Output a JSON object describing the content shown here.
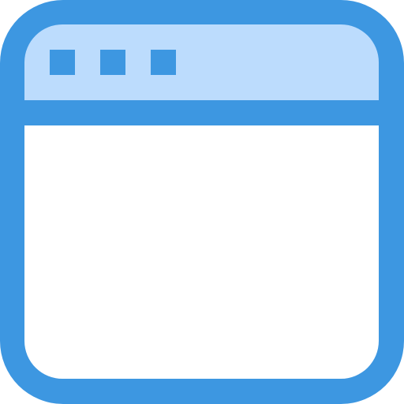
{
  "icon": {
    "name": "browser-window-icon",
    "colors": {
      "stroke": "#3d97e1",
      "title_bar_fill": "#bcdcfd",
      "body_fill": "#ffffff"
    },
    "title_bar": {
      "controls": [
        {
          "name": "window-control-dot-1"
        },
        {
          "name": "window-control-dot-2"
        },
        {
          "name": "window-control-dot-3"
        }
      ]
    }
  }
}
